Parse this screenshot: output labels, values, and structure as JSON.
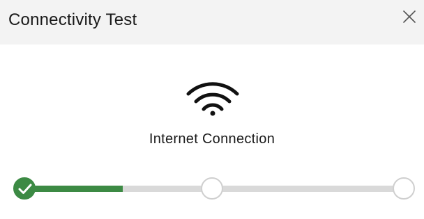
{
  "dialog": {
    "title": "Connectivity Test",
    "close_icon": "close-icon"
  },
  "test": {
    "icon": "wifi-icon",
    "label": "Internet Connection"
  },
  "progress": {
    "fraction": 0.26,
    "steps": [
      {
        "state": "complete",
        "icon": "checkmark-icon"
      },
      {
        "state": "pending"
      },
      {
        "state": "pending"
      }
    ]
  },
  "colors": {
    "header_bg": "#f3f3f3",
    "accent_green": "#3c8a44",
    "track_gray": "#d9d9d9",
    "pending_border": "#cfcfcf"
  }
}
